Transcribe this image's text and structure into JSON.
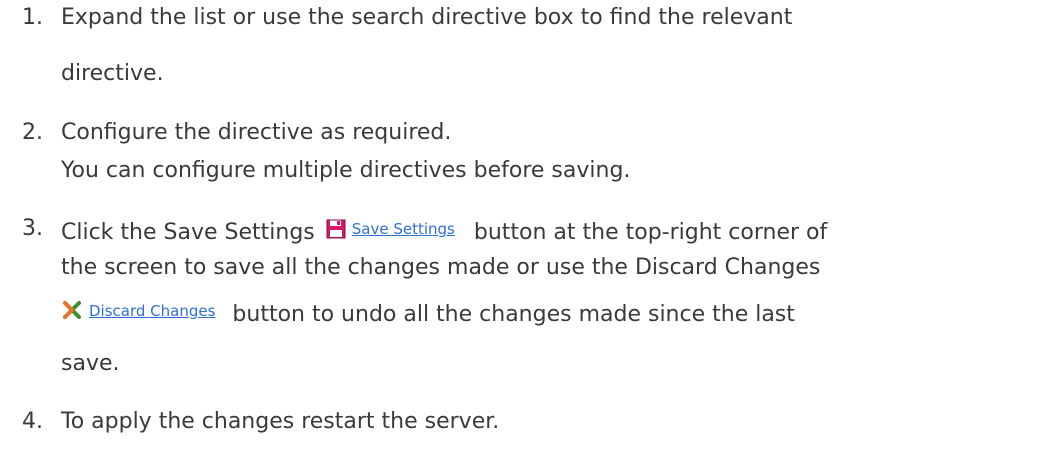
{
  "steps": [
    {
      "number": "1.",
      "line1": "Expand the list or use the search directive box to find the relevant",
      "line2": "directive."
    },
    {
      "number": "2.",
      "line1": "Configure the directive as required.",
      "line2": "You can configure multiple directives before saving."
    },
    {
      "number": "3.",
      "line1_before": "Click the Save Settings",
      "save_link_label": "Save Settings",
      "line1_after": "button at the top-right corner of",
      "line2": "the screen to save all the changes made or use the Discard Changes",
      "discard_link_label": "Discard Changes",
      "line3_after": "button to undo all the changes made since the last",
      "line4": "save."
    },
    {
      "number": "4.",
      "line1": "To apply the changes restart the server."
    }
  ],
  "icons": {
    "save": "floppy-disk-icon",
    "discard": "x-cross-icon"
  },
  "colors": {
    "text": "#3a3a3a",
    "link": "#2f6fd6",
    "save_icon": "#d6186c",
    "discard_icon_green": "#3a8f2a",
    "discard_icon_orange": "#e8742a"
  }
}
